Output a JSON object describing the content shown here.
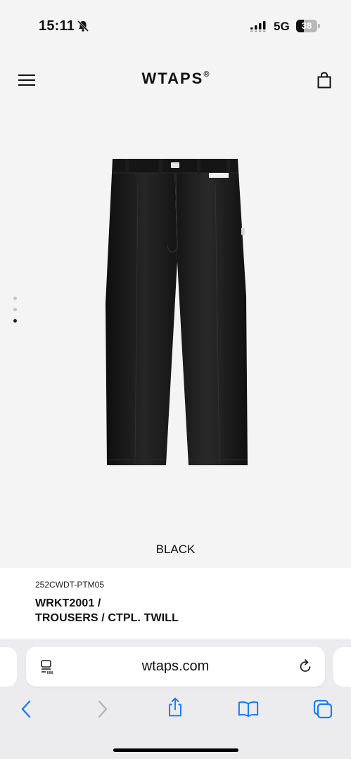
{
  "status_bar": {
    "time": "15:11",
    "network": "5G",
    "battery": "38",
    "battery_level": 0.38,
    "bell_icon": "bell-slash-icon",
    "signal_icon": "cellular-signal-icon"
  },
  "header": {
    "menu_icon": "hamburger-menu-icon",
    "logo": "WTAPS",
    "logo_mark": "®",
    "bag_icon": "shopping-bag-icon"
  },
  "gallery": {
    "image_icon": "black-trousers-image",
    "image_count": 3,
    "active_index": 2
  },
  "product": {
    "color": "BLACK",
    "code": "252CWDT-PTM05",
    "name_line1": "WRKT2001 /",
    "name_line2": "TROUSERS / CTPL. TWILL"
  },
  "browser": {
    "url": "wtaps.com",
    "page_menu_icon": "page-menu-icon",
    "reload_icon": "reload-icon",
    "nav_icons": [
      "back-icon",
      "forward-icon",
      "share-icon",
      "bookmarks-icon",
      "tabs-icon"
    ],
    "accent_color": "#1a7cf5"
  },
  "colors": {
    "page_background": "#f4f4f4",
    "panel_background": "#ffffff",
    "toolbar_background": "#ececee",
    "text": "#111111"
  }
}
